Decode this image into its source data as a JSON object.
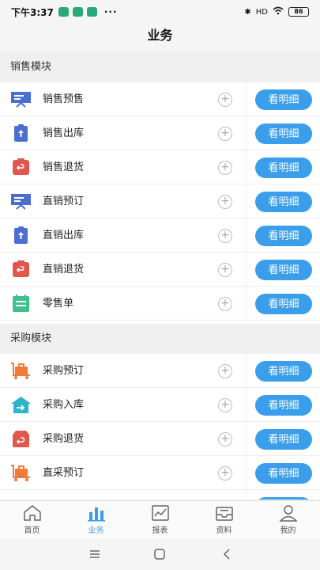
{
  "status_bar": {
    "time": "下午3:37",
    "more": "···",
    "network": "HD",
    "battery": "86"
  },
  "header": {
    "title": "业务"
  },
  "sections": [
    {
      "title": "销售模块",
      "items": [
        {
          "label": "销售预售",
          "icon": "presentation-board-icon",
          "color": "#4a6fd1",
          "button": "看明细"
        },
        {
          "label": "销售出库",
          "icon": "clipboard-upload-icon",
          "color": "#4a6fd1",
          "button": "看明细"
        },
        {
          "label": "销售退货",
          "icon": "clipboard-return-icon",
          "color": "#e2574c",
          "button": "看明细"
        },
        {
          "label": "直销预订",
          "icon": "presentation-board-icon",
          "color": "#4a6fd1",
          "button": "看明细"
        },
        {
          "label": "直销出库",
          "icon": "clipboard-upload-icon",
          "color": "#4a6fd1",
          "button": "看明细"
        },
        {
          "label": "直销退货",
          "icon": "clipboard-return-icon",
          "color": "#e2574c",
          "button": "看明细"
        },
        {
          "label": "零售单",
          "icon": "calendar-list-icon",
          "color": "#3fc08f",
          "button": "看明细"
        }
      ]
    },
    {
      "title": "采购模块",
      "items": [
        {
          "label": "采购预订",
          "icon": "luggage-cart-icon",
          "color": "#f07a3a",
          "button": "看明细"
        },
        {
          "label": "采购入库",
          "icon": "warehouse-icon",
          "color": "#2bb5c9",
          "button": "看明细"
        },
        {
          "label": "采购退货",
          "icon": "box-return-icon",
          "color": "#e2574c",
          "button": "看明细"
        },
        {
          "label": "直采预订",
          "icon": "luggage-cart-icon",
          "color": "#f07a3a",
          "button": "看明细"
        }
      ]
    }
  ],
  "tabs": [
    {
      "label": "首页",
      "icon": "home-icon",
      "active": false
    },
    {
      "label": "业务",
      "icon": "bar-chart-icon",
      "active": true
    },
    {
      "label": "报表",
      "icon": "line-chart-icon",
      "active": false
    },
    {
      "label": "资料",
      "icon": "inbox-icon",
      "active": false
    },
    {
      "label": "我的",
      "icon": "user-icon",
      "active": false
    }
  ],
  "colors": {
    "accent": "#3b9eea",
    "section_bg": "#efefef"
  }
}
